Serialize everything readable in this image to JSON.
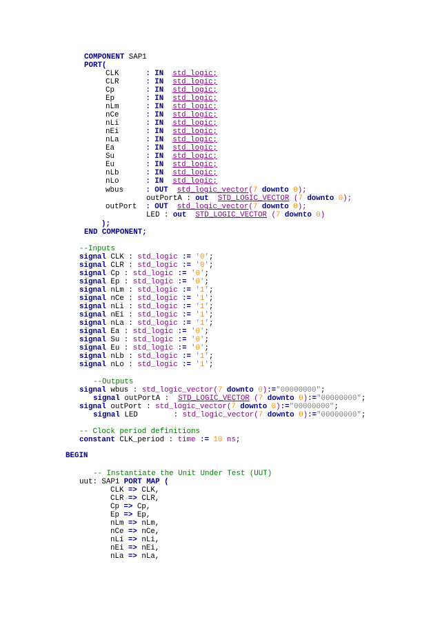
{
  "lines": [
    [
      [
        "kw",
        "COMPONENT"
      ],
      [
        "tx",
        " SAP1"
      ]
    ],
    [
      [
        "kw",
        "PORT("
      ]
    ],
    [
      [
        "tx",
        "CLK      "
      ],
      [
        "op",
        ": IN"
      ],
      [
        "tx",
        "  "
      ],
      [
        "ty",
        "std_logic;"
      ]
    ],
    [
      [
        "tx",
        "CLR      "
      ],
      [
        "op",
        ": IN"
      ],
      [
        "tx",
        "  "
      ],
      [
        "ty",
        "std_logic;"
      ]
    ],
    [
      [
        "tx",
        "Cp       "
      ],
      [
        "op",
        ": IN"
      ],
      [
        "tx",
        "  "
      ],
      [
        "ty",
        "std_logic;"
      ]
    ],
    [
      [
        "tx",
        "Ep       "
      ],
      [
        "op",
        ": IN"
      ],
      [
        "tx",
        "  "
      ],
      [
        "ty",
        "std_logic;"
      ]
    ],
    [
      [
        "tx",
        "nLm      "
      ],
      [
        "op",
        ": IN"
      ],
      [
        "tx",
        "  "
      ],
      [
        "ty",
        "std_logic;"
      ]
    ],
    [
      [
        "tx",
        "nCe      "
      ],
      [
        "op",
        ": IN"
      ],
      [
        "tx",
        "  "
      ],
      [
        "ty",
        "std_logic;"
      ]
    ],
    [
      [
        "tx",
        "nLi      "
      ],
      [
        "op",
        ": IN"
      ],
      [
        "tx",
        "  "
      ],
      [
        "ty",
        "std_logic;"
      ]
    ],
    [
      [
        "tx",
        "nEi      "
      ],
      [
        "op",
        ": IN"
      ],
      [
        "tx",
        "  "
      ],
      [
        "ty",
        "std_logic;"
      ]
    ],
    [
      [
        "tx",
        "nLa      "
      ],
      [
        "op",
        ": IN"
      ],
      [
        "tx",
        "  "
      ],
      [
        "ty",
        "std_logic;"
      ]
    ],
    [
      [
        "tx",
        "Ea       "
      ],
      [
        "op",
        ": IN"
      ],
      [
        "tx",
        "  "
      ],
      [
        "ty",
        "std_logic;"
      ]
    ],
    [
      [
        "tx",
        "Su       "
      ],
      [
        "op",
        ": IN"
      ],
      [
        "tx",
        "  "
      ],
      [
        "ty",
        "std_logic;"
      ]
    ],
    [
      [
        "tx",
        "Eu       "
      ],
      [
        "op",
        ": IN"
      ],
      [
        "tx",
        "  "
      ],
      [
        "ty",
        "std_logic;"
      ]
    ],
    [
      [
        "tx",
        "nLb      "
      ],
      [
        "op",
        ": IN"
      ],
      [
        "tx",
        "  "
      ],
      [
        "ty",
        "std_logic;"
      ]
    ],
    [
      [
        "tx",
        "nLo      "
      ],
      [
        "op",
        ": IN"
      ],
      [
        "tx",
        "  "
      ],
      [
        "ty",
        "std_logic;"
      ]
    ],
    [
      [
        "tx",
        "wbus     "
      ],
      [
        "op",
        ": OUT"
      ],
      [
        "tx",
        "  "
      ],
      [
        "ty",
        "std_logic_vector"
      ],
      [
        "tyn",
        "("
      ],
      [
        "num",
        "7"
      ],
      [
        "tx",
        " "
      ],
      [
        "kw",
        "downto"
      ],
      [
        "tx",
        " "
      ],
      [
        "num",
        "0"
      ],
      [
        "tyn",
        ");"
      ]
    ],
    [
      [
        "tx",
        "outPortA : "
      ],
      [
        "kw",
        "out"
      ],
      [
        "tx",
        "  "
      ],
      [
        "ty",
        "STD_LOGIC_VECTOR"
      ],
      [
        "tx",
        " "
      ],
      [
        "tyn",
        "("
      ],
      [
        "num",
        "7"
      ],
      [
        "tx",
        " "
      ],
      [
        "kw",
        "downto"
      ],
      [
        "tx",
        " "
      ],
      [
        "num",
        "0"
      ],
      [
        "tyn",
        ");"
      ]
    ],
    [
      [
        "tx",
        "outPort  "
      ],
      [
        "op",
        ": OUT"
      ],
      [
        "tx",
        "  "
      ],
      [
        "ty",
        "std_logic_vector"
      ],
      [
        "tyn",
        "("
      ],
      [
        "num",
        "7"
      ],
      [
        "tx",
        " "
      ],
      [
        "kw",
        "downto"
      ],
      [
        "tx",
        " "
      ],
      [
        "num",
        "0"
      ],
      [
        "tyn",
        ");"
      ]
    ],
    [
      [
        "tx",
        "LED : "
      ],
      [
        "kw",
        "out"
      ],
      [
        "tx",
        "  "
      ],
      [
        "ty",
        "STD_LOGIC_VECTOR"
      ],
      [
        "tx",
        " "
      ],
      [
        "tyn",
        "("
      ],
      [
        "num",
        "7"
      ],
      [
        "tx",
        " "
      ],
      [
        "kw",
        "downto"
      ],
      [
        "tx",
        " "
      ],
      [
        "num",
        "0"
      ],
      [
        "tyn",
        ")"
      ]
    ],
    [
      [
        "kw",
        ");"
      ]
    ],
    [
      [
        "kw",
        "END COMPONENT;"
      ]
    ],
    [],
    [
      [
        "cm",
        "--Inputs"
      ]
    ],
    [
      [
        "kw",
        "signal"
      ],
      [
        "tx",
        " CLK : "
      ],
      [
        "tyn",
        "std_logic"
      ],
      [
        "tx",
        " "
      ],
      [
        "op",
        ":="
      ],
      [
        "tx",
        " "
      ],
      [
        "str",
        "'"
      ],
      [
        "num",
        "0"
      ],
      [
        "str",
        "'"
      ],
      [
        "tx",
        ";"
      ]
    ],
    [
      [
        "kw",
        "signal"
      ],
      [
        "tx",
        " CLR : "
      ],
      [
        "tyn",
        "std_logic"
      ],
      [
        "tx",
        " "
      ],
      [
        "op",
        ":="
      ],
      [
        "tx",
        " "
      ],
      [
        "str",
        "'"
      ],
      [
        "num",
        "0"
      ],
      [
        "str",
        "'"
      ],
      [
        "tx",
        ";"
      ]
    ],
    [
      [
        "kw",
        "signal"
      ],
      [
        "tx",
        " Cp : "
      ],
      [
        "tyn",
        "std_logic"
      ],
      [
        "tx",
        " "
      ],
      [
        "op",
        ":="
      ],
      [
        "tx",
        " "
      ],
      [
        "str",
        "'"
      ],
      [
        "num",
        "0"
      ],
      [
        "str",
        "'"
      ],
      [
        "tx",
        ";"
      ]
    ],
    [
      [
        "kw",
        "signal"
      ],
      [
        "tx",
        " Ep : "
      ],
      [
        "tyn",
        "std_logic"
      ],
      [
        "tx",
        " "
      ],
      [
        "op",
        ":="
      ],
      [
        "tx",
        " "
      ],
      [
        "str",
        "'"
      ],
      [
        "num",
        "0"
      ],
      [
        "str",
        "'"
      ],
      [
        "tx",
        ";"
      ]
    ],
    [
      [
        "kw",
        "signal"
      ],
      [
        "tx",
        " nLm : "
      ],
      [
        "tyn",
        "std_logic"
      ],
      [
        "tx",
        " "
      ],
      [
        "op",
        ":="
      ],
      [
        "tx",
        " "
      ],
      [
        "str",
        "'"
      ],
      [
        "num",
        "1"
      ],
      [
        "str",
        "'"
      ],
      [
        "tx",
        ";"
      ]
    ],
    [
      [
        "kw",
        "signal"
      ],
      [
        "tx",
        " nCe : "
      ],
      [
        "tyn",
        "std_logic"
      ],
      [
        "tx",
        " "
      ],
      [
        "op",
        ":="
      ],
      [
        "tx",
        " "
      ],
      [
        "str",
        "'"
      ],
      [
        "num",
        "1"
      ],
      [
        "str",
        "'"
      ],
      [
        "tx",
        ";"
      ]
    ],
    [
      [
        "kw",
        "signal"
      ],
      [
        "tx",
        " nLi : "
      ],
      [
        "tyn",
        "std_logic"
      ],
      [
        "tx",
        " "
      ],
      [
        "op",
        ":="
      ],
      [
        "tx",
        " "
      ],
      [
        "str",
        "'"
      ],
      [
        "num",
        "1"
      ],
      [
        "str",
        "'"
      ],
      [
        "tx",
        ";"
      ]
    ],
    [
      [
        "kw",
        "signal"
      ],
      [
        "tx",
        " nEi : "
      ],
      [
        "tyn",
        "std_logic"
      ],
      [
        "tx",
        " "
      ],
      [
        "op",
        ":="
      ],
      [
        "tx",
        " "
      ],
      [
        "str",
        "'"
      ],
      [
        "num",
        "1"
      ],
      [
        "str",
        "'"
      ],
      [
        "tx",
        ";"
      ]
    ],
    [
      [
        "kw",
        "signal"
      ],
      [
        "tx",
        " nLa : "
      ],
      [
        "tyn",
        "std_logic"
      ],
      [
        "tx",
        " "
      ],
      [
        "op",
        ":="
      ],
      [
        "tx",
        " "
      ],
      [
        "str",
        "'"
      ],
      [
        "num",
        "1"
      ],
      [
        "str",
        "'"
      ],
      [
        "tx",
        ";"
      ]
    ],
    [
      [
        "kw",
        "signal"
      ],
      [
        "tx",
        " Ea : "
      ],
      [
        "tyn",
        "std_logic"
      ],
      [
        "tx",
        " "
      ],
      [
        "op",
        ":="
      ],
      [
        "tx",
        " "
      ],
      [
        "str",
        "'"
      ],
      [
        "num",
        "0"
      ],
      [
        "str",
        "'"
      ],
      [
        "tx",
        ";"
      ]
    ],
    [
      [
        "kw",
        "signal"
      ],
      [
        "tx",
        " Su : "
      ],
      [
        "tyn",
        "std_logic"
      ],
      [
        "tx",
        " "
      ],
      [
        "op",
        ":="
      ],
      [
        "tx",
        " "
      ],
      [
        "str",
        "'"
      ],
      [
        "num",
        "0"
      ],
      [
        "str",
        "'"
      ],
      [
        "tx",
        ";"
      ]
    ],
    [
      [
        "kw",
        "signal"
      ],
      [
        "tx",
        " Eu : "
      ],
      [
        "tyn",
        "std_logic"
      ],
      [
        "tx",
        " "
      ],
      [
        "op",
        ":="
      ],
      [
        "tx",
        " "
      ],
      [
        "str",
        "'"
      ],
      [
        "num",
        "0"
      ],
      [
        "str",
        "'"
      ],
      [
        "tx",
        ";"
      ]
    ],
    [
      [
        "kw",
        "signal"
      ],
      [
        "tx",
        " nLb : "
      ],
      [
        "tyn",
        "std_logic"
      ],
      [
        "tx",
        " "
      ],
      [
        "op",
        ":="
      ],
      [
        "tx",
        " "
      ],
      [
        "str",
        "'"
      ],
      [
        "num",
        "1"
      ],
      [
        "str",
        "'"
      ],
      [
        "tx",
        ";"
      ]
    ],
    [
      [
        "kw",
        "signal"
      ],
      [
        "tx",
        " nLo : "
      ],
      [
        "tyn",
        "std_logic"
      ],
      [
        "tx",
        " "
      ],
      [
        "op",
        ":="
      ],
      [
        "tx",
        " "
      ],
      [
        "str",
        "'"
      ],
      [
        "num",
        "1"
      ],
      [
        "str",
        "'"
      ],
      [
        "tx",
        ";"
      ]
    ],
    [],
    [
      [
        "cm",
        "--Outputs"
      ]
    ],
    [
      [
        "kw",
        "signal"
      ],
      [
        "tx",
        " wbus : "
      ],
      [
        "tyn",
        "std_logic_vector("
      ],
      [
        "num",
        "7"
      ],
      [
        "tx",
        " "
      ],
      [
        "kw",
        "downto"
      ],
      [
        "tx",
        " "
      ],
      [
        "num",
        "0"
      ],
      [
        "tyn",
        ")"
      ],
      [
        "op",
        ":="
      ],
      [
        "str",
        "\"00000000\""
      ],
      [
        "tx",
        ";"
      ]
    ],
    [
      [
        "kw",
        "signal"
      ],
      [
        "tx",
        " outPortA :  "
      ],
      [
        "ty",
        "STD_LOGIC_VECTOR"
      ],
      [
        "tx",
        " "
      ],
      [
        "tyn",
        "("
      ],
      [
        "num",
        "7"
      ],
      [
        "tx",
        " "
      ],
      [
        "kw",
        "downto"
      ],
      [
        "tx",
        " "
      ],
      [
        "num",
        "0"
      ],
      [
        "tyn",
        ")"
      ],
      [
        "op",
        ":="
      ],
      [
        "str",
        "\"00000000\""
      ],
      [
        "tx",
        ";"
      ]
    ],
    [
      [
        "kw",
        "signal"
      ],
      [
        "tx",
        " outPort : "
      ],
      [
        "tyn",
        "std_logic_vector("
      ],
      [
        "num",
        "7"
      ],
      [
        "tx",
        " "
      ],
      [
        "kw",
        "downto"
      ],
      [
        "tx",
        " "
      ],
      [
        "num",
        "0"
      ],
      [
        "tyn",
        ")"
      ],
      [
        "op",
        ":="
      ],
      [
        "str",
        "\"00000000\""
      ],
      [
        "tx",
        ";"
      ]
    ],
    [
      [
        "kw",
        "signal"
      ],
      [
        "tx",
        " LED        : "
      ],
      [
        "tyn",
        "std_logic_vector("
      ],
      [
        "num",
        "7"
      ],
      [
        "tx",
        " "
      ],
      [
        "kw",
        "downto"
      ],
      [
        "tx",
        " "
      ],
      [
        "num",
        "0"
      ],
      [
        "tyn",
        ")"
      ],
      [
        "op",
        ":="
      ],
      [
        "str",
        "\"00000000\""
      ],
      [
        "tx",
        ";"
      ]
    ],
    [],
    [
      [
        "cm",
        "-- Clock period definitions"
      ]
    ],
    [
      [
        "kw",
        "constant"
      ],
      [
        "tx",
        " CLK_period : "
      ],
      [
        "tyn",
        "time"
      ],
      [
        "tx",
        " "
      ],
      [
        "op",
        ":="
      ],
      [
        "tx",
        " "
      ],
      [
        "num",
        "10"
      ],
      [
        "tx",
        " "
      ],
      [
        "tyn",
        "ns"
      ],
      [
        "tx",
        ";"
      ]
    ],
    [],
    [
      [
        "kw",
        "BEGIN"
      ]
    ],
    [],
    [
      [
        "cm",
        "-- Instantiate the Unit Under Test (UUT)"
      ]
    ],
    [
      [
        "tx",
        "uut: SAP1 "
      ],
      [
        "kw",
        "PORT MAP ("
      ]
    ],
    [
      [
        "tx",
        "CLK "
      ],
      [
        "op",
        "=>"
      ],
      [
        "tx",
        " CLK,"
      ]
    ],
    [
      [
        "tx",
        "CLR "
      ],
      [
        "op",
        "=>"
      ],
      [
        "tx",
        " CLR,"
      ]
    ],
    [
      [
        "tx",
        "Cp "
      ],
      [
        "op",
        "=>"
      ],
      [
        "tx",
        " Cp,"
      ]
    ],
    [
      [
        "tx",
        "Ep "
      ],
      [
        "op",
        "=>"
      ],
      [
        "tx",
        " Ep,"
      ]
    ],
    [
      [
        "tx",
        "nLm "
      ],
      [
        "op",
        "=>"
      ],
      [
        "tx",
        " nLm,"
      ]
    ],
    [
      [
        "tx",
        "nCe "
      ],
      [
        "op",
        "=>"
      ],
      [
        "tx",
        " nCe,"
      ]
    ],
    [
      [
        "tx",
        "nLi "
      ],
      [
        "op",
        "=>"
      ],
      [
        "tx",
        " nLi,"
      ]
    ],
    [
      [
        "tx",
        "nEi "
      ],
      [
        "op",
        "=>"
      ],
      [
        "tx",
        " nEi,"
      ]
    ],
    [
      [
        "tx",
        "nLa "
      ],
      [
        "op",
        "=>"
      ],
      [
        "tx",
        " nLa,"
      ]
    ]
  ]
}
